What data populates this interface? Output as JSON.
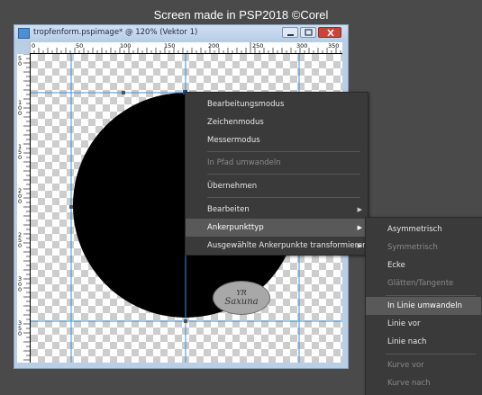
{
  "caption": "Screen made in PSP2018 ©Corel",
  "window": {
    "title": "tropfenform.pspimage* @ 120% (Vektor 1)"
  },
  "ruler": {
    "top_labels": [
      "0",
      "50",
      "100",
      "150",
      "200",
      "250",
      "300",
      "350"
    ],
    "left_labels": [
      "50",
      "100",
      "150",
      "200",
      "250",
      "300",
      "350"
    ]
  },
  "watermark": {
    "line1": "YR",
    "line2": "Saxuna"
  },
  "context_menu": {
    "items": [
      {
        "label": "Bearbeitungsmodus",
        "enabled": true
      },
      {
        "label": "Zeichenmodus",
        "enabled": true
      },
      {
        "label": "Messermodus",
        "enabled": true
      },
      {
        "label": "In Pfad umwandeln",
        "enabled": false
      },
      {
        "label": "Übernehmen",
        "enabled": true
      },
      {
        "label": "Bearbeiten",
        "enabled": true,
        "submenu": true
      },
      {
        "label": "Ankerpunkttyp",
        "enabled": true,
        "submenu": true,
        "highlighted": true
      },
      {
        "label": "Ausgewählte Ankerpunkte transformieren",
        "enabled": true,
        "submenu": true
      }
    ]
  },
  "submenu": {
    "items": [
      {
        "label": "Asymmetrisch",
        "enabled": true
      },
      {
        "label": "Symmetrisch",
        "enabled": false
      },
      {
        "label": "Ecke",
        "enabled": true
      },
      {
        "label": "Glätten/Tangente",
        "enabled": false
      },
      {
        "label": "In Linie umwandeln",
        "enabled": true,
        "highlighted": true
      },
      {
        "label": "Linie vor",
        "enabled": true
      },
      {
        "label": "Linie nach",
        "enabled": true
      },
      {
        "label": "Kurve vor",
        "enabled": false
      },
      {
        "label": "Kurve nach",
        "enabled": false
      }
    ]
  },
  "icons": {
    "submenu_arrow": "submenu-arrow-icon",
    "document": "document-icon"
  }
}
